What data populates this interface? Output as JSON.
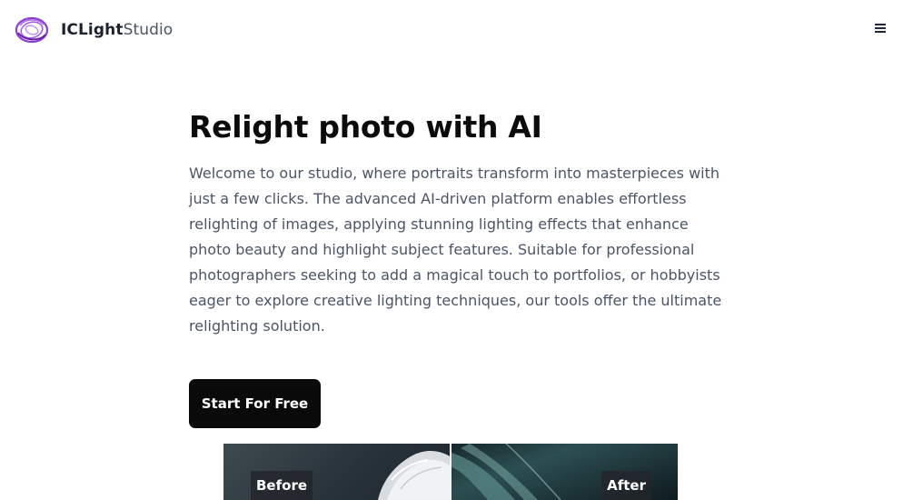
{
  "navbar": {
    "brand_strong": "ICLight",
    "brand_light": "Studio",
    "logo_icon": "swirl-logo-icon",
    "menu_icon": "hamburger-menu-icon",
    "brand_accent": "#8a3fd1"
  },
  "hero": {
    "title": "Relight photo with AI",
    "description": "Welcome to our studio, where portraits transform into masterpieces with just a few clicks. The advanced AI-driven platform enables effortless relighting of images, applying stunning lighting effects that enhance photo beauty and highlight subject features. Suitable for professional photographers seeking to add a magical touch to portfolios, or hobbyists eager to explore creative lighting techniques, our tools offer the ultimate relighting solution.",
    "cta_label": "Start For Free"
  },
  "comparison": {
    "before_label": "Before",
    "after_label": "After"
  }
}
